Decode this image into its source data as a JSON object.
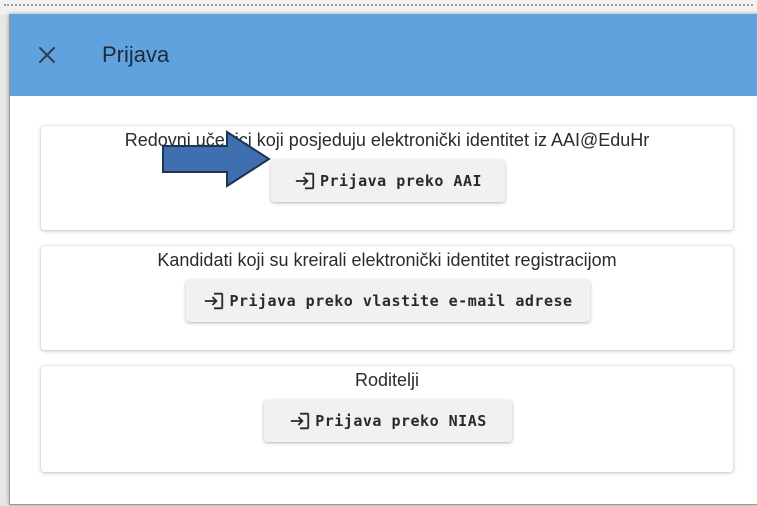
{
  "dialog": {
    "title": "Prijava",
    "close_icon": "close-icon"
  },
  "cards": [
    {
      "label": "Redovni učenici koji posjeduju elektronički identitet iz AAI@EduHr",
      "button": "Prijava preko AAI",
      "icon": "login-icon"
    },
    {
      "label": "Kandidati koji su kreirali elektronički identitet registracijom",
      "button": "Prijava preko vlastite e-mail adrese",
      "icon": "login-icon"
    },
    {
      "label": "Roditelji",
      "button": "Prijava preko NIAS",
      "icon": "login-icon"
    }
  ],
  "colors": {
    "header": "#5fa2dd",
    "annotation_arrow": "#3f6fae",
    "annotation_arrow_outline": "#1e3557"
  }
}
